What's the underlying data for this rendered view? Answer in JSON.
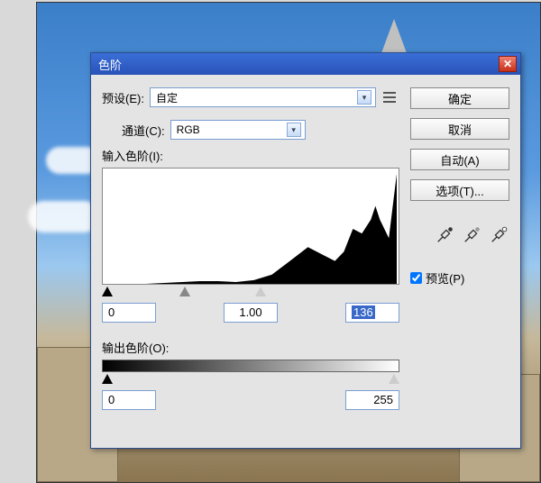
{
  "dialog": {
    "title": "色阶",
    "preset_label": "预设(E):",
    "preset_value": "自定",
    "channel_label": "通道(C):",
    "channel_value": "RGB",
    "input_levels_label": "输入色阶(I):",
    "output_levels_label": "输出色阶(O):",
    "input": {
      "shadow": "0",
      "gamma": "1.00",
      "highlight": "136"
    },
    "output": {
      "shadow": "0",
      "highlight": "255"
    },
    "buttons": {
      "ok": "确定",
      "cancel": "取消",
      "auto": "自动(A)",
      "options": "选项(T)..."
    },
    "preview_label": "预览(P)",
    "preview_checked": true
  },
  "chart_data": {
    "type": "area",
    "title": "",
    "xlabel": "",
    "ylabel": "",
    "x_range": [
      0,
      255
    ],
    "note": "Luminance histogram; values are approximate relative pixel counts read from the graphic.",
    "x": [
      0,
      16,
      32,
      48,
      64,
      80,
      96,
      112,
      128,
      144,
      160,
      176,
      192,
      200,
      208,
      216,
      224,
      232,
      236,
      240,
      244,
      248,
      252,
      255
    ],
    "values": [
      0,
      0,
      0,
      1,
      2,
      3,
      3,
      2,
      4,
      10,
      25,
      40,
      30,
      25,
      35,
      60,
      55,
      70,
      85,
      70,
      60,
      50,
      90,
      120
    ]
  }
}
